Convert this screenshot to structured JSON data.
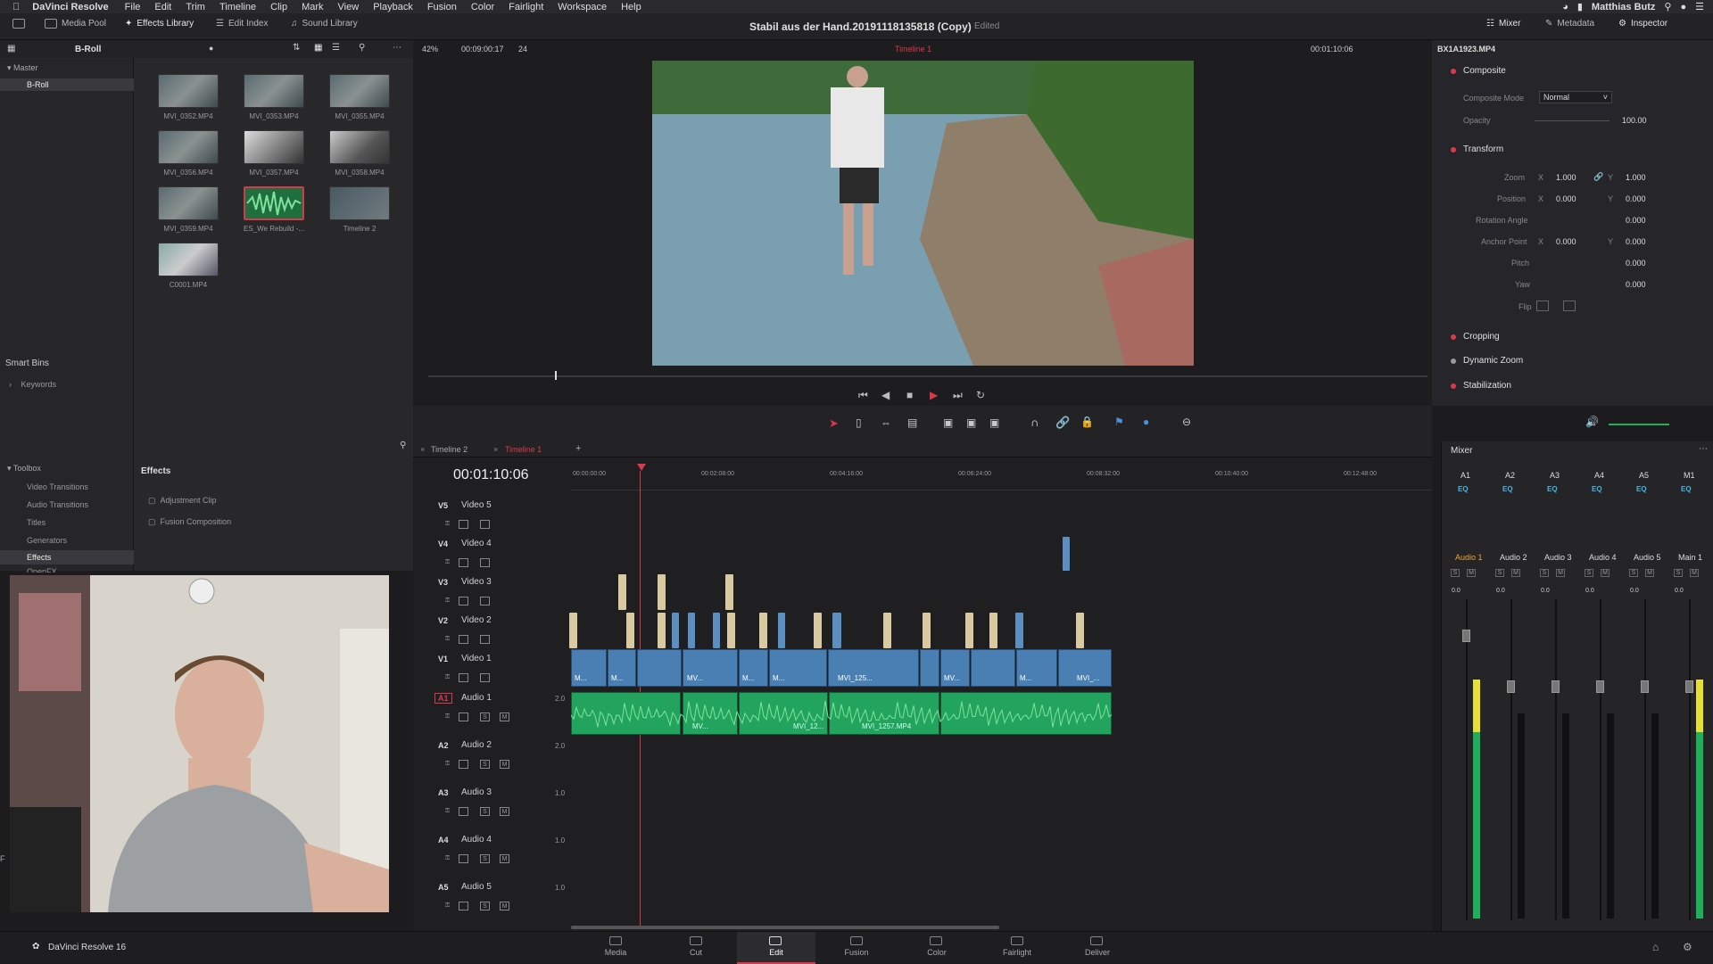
{
  "menubar": {
    "app": "DaVinci Resolve",
    "items": [
      "File",
      "Edit",
      "Trim",
      "Timeline",
      "Clip",
      "Mark",
      "View",
      "Playback",
      "Fusion",
      "Color",
      "Fairlight",
      "Workspace",
      "Help"
    ],
    "user": "Matthias Butz"
  },
  "toolbar": {
    "media_pool": "Media Pool",
    "effects_library": "Effects Library",
    "edit_index": "Edit Index",
    "sound_library": "Sound Library",
    "project_title": "Stabil aus der Hand.20191118135818 (Copy)",
    "edited": "Edited",
    "mixer": "Mixer",
    "metadata": "Metadata",
    "inspector": "Inspector"
  },
  "media_pool": {
    "bin": "B-Roll",
    "master": "Master",
    "broll_item": "B-Roll",
    "smart_bins": "Smart Bins",
    "keywords": "Keywords",
    "clips": [
      "MVI_0352.MP4",
      "MVI_0353.MP4",
      "MVI_0355.MP4",
      "MVI_0356.MP4",
      "MVI_0357.MP4",
      "MVI_0358.MP4",
      "MVI_0359.MP4",
      "ES_We Rebuild -...",
      "Timeline 2",
      "C0001.MP4"
    ]
  },
  "viewer": {
    "zoom": "42%",
    "source_tc": "00:09:00:17",
    "frames": "24",
    "timeline_name": "Timeline 1",
    "record_tc": "00:01:10:06"
  },
  "effects": {
    "toolbox": "Toolbox",
    "categories": [
      "Video Transitions",
      "Audio Transitions",
      "Titles",
      "Generators",
      "Effects",
      "OpenFX"
    ],
    "header": "Effects",
    "items": [
      "Adjustment Clip",
      "Fusion Composition"
    ]
  },
  "timeline": {
    "tabs": [
      "Timeline 2",
      "Timeline 1"
    ],
    "timecode": "00:01:10:06",
    "ruler": [
      "00:00:00:00",
      "00:02:08:00",
      "00:04:16:00",
      "00:06:24:00",
      "00:08:32:00",
      "00:10:40:00",
      "00:12:48:00"
    ],
    "tracks": [
      {
        "id": "V5",
        "name": "Video 5"
      },
      {
        "id": "V4",
        "name": "Video 4"
      },
      {
        "id": "V3",
        "name": "Video 3"
      },
      {
        "id": "V2",
        "name": "Video 2"
      },
      {
        "id": "V1",
        "name": "Video 1"
      },
      {
        "id": "A1",
        "name": "Audio 1",
        "level": "2.0"
      },
      {
        "id": "A2",
        "name": "Audio 2",
        "level": "2.0"
      },
      {
        "id": "A3",
        "name": "Audio 3",
        "level": "1.0"
      },
      {
        "id": "A4",
        "name": "Audio 4",
        "level": "1.0"
      },
      {
        "id": "A5",
        "name": "Audio 5",
        "level": "1.0"
      }
    ],
    "v1_labels": [
      "M...",
      "M...",
      "MV...",
      "M...",
      "M...",
      "MVI_125...",
      "MV...",
      "M...",
      "MVI_..."
    ],
    "a1_labels": [
      "MV...",
      "MVI_12...",
      "MVI_1257.MP4"
    ]
  },
  "inspector": {
    "clip": "BX1A1923.MP4",
    "composite": "Composite",
    "composite_mode_label": "Composite Mode",
    "composite_mode": "Normal",
    "opacity_label": "Opacity",
    "opacity": "100.00",
    "transform": "Transform",
    "zoom_label": "Zoom",
    "zoom_x": "1.000",
    "zoom_y": "1.000",
    "position_label": "Position",
    "pos_x": "0.000",
    "pos_y": "0.000",
    "rotation_label": "Rotation Angle",
    "rotation": "0.000",
    "anchor_label": "Anchor Point",
    "anchor_x": "0.000",
    "anchor_y": "0.000",
    "pitch_label": "Pitch",
    "pitch": "0.000",
    "yaw_label": "Yaw",
    "yaw": "0.000",
    "flip_label": "Flip",
    "x": "X",
    "y": "Y",
    "cropping": "Cropping",
    "dynamic_zoom": "Dynamic Zoom",
    "stabilization": "Stabilization"
  },
  "mixer": {
    "title": "Mixer",
    "channels": [
      "A1",
      "A2",
      "A3",
      "A4",
      "A5",
      "M1"
    ],
    "eq": "EQ",
    "names": [
      "Audio 1",
      "Audio 2",
      "Audio 3",
      "Audio 4",
      "Audio 5",
      "Main 1"
    ],
    "levels": [
      "0.0",
      "0.0",
      "0.0",
      "0.0",
      "0.0",
      "0.0"
    ],
    "s": "S",
    "m": "M"
  },
  "pages": [
    "Media",
    "Cut",
    "Edit",
    "Fusion",
    "Color",
    "Fairlight",
    "Deliver"
  ],
  "footer": {
    "brand": "DaVinci Resolve 16"
  },
  "colors": {
    "accent": "#d8394b",
    "audio": "#22a45e",
    "video": "#4a7fb4",
    "eq": "#46b6e6"
  }
}
